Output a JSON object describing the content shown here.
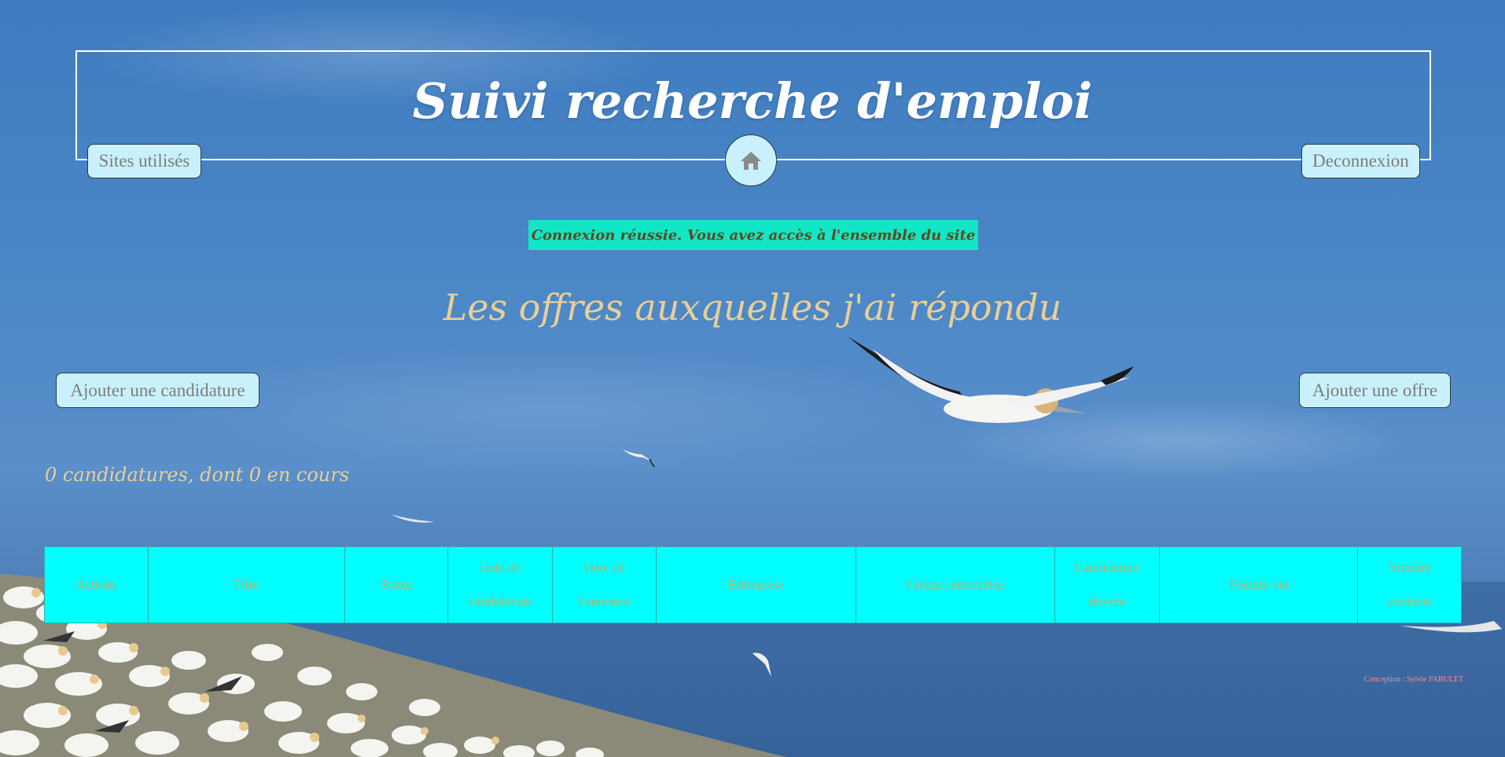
{
  "header": {
    "title": "Suivi recherche d'emploi",
    "nav_left_label": "Sites utilisés",
    "nav_right_label": "Deconnexion",
    "home_icon": "home-icon"
  },
  "flash_message": "Connexion réussie. Vous avez accès à l'ensemble du site",
  "main": {
    "subtitle": "Les offres auxquelles j'ai répondu",
    "add_application_label": "Ajouter une candidature",
    "add_offer_label": "Ajouter une offre",
    "summary": "0 candidatures, dont 0 en cours"
  },
  "table": {
    "columns": [
      [
        "Actions"
      ],
      [
        "Titre"
      ],
      [
        "Statut"
      ],
      [
        "Date de",
        "candidature"
      ],
      [
        "Date de",
        "l'annonce"
      ],
      [
        "Entreprise"
      ],
      [
        "Contact entreprise"
      ],
      [
        "Candidature",
        "directe"
      ],
      [
        "Postulé via"
      ],
      [
        "Nombre",
        "contacts"
      ]
    ]
  },
  "footer": "Conception : Sylvie FABULET",
  "colors": {
    "button_bg": "#c9f1fb",
    "table_bg": "#00ffff",
    "flash_bg": "#13e6c6",
    "accent_text": "#e8cf95"
  }
}
